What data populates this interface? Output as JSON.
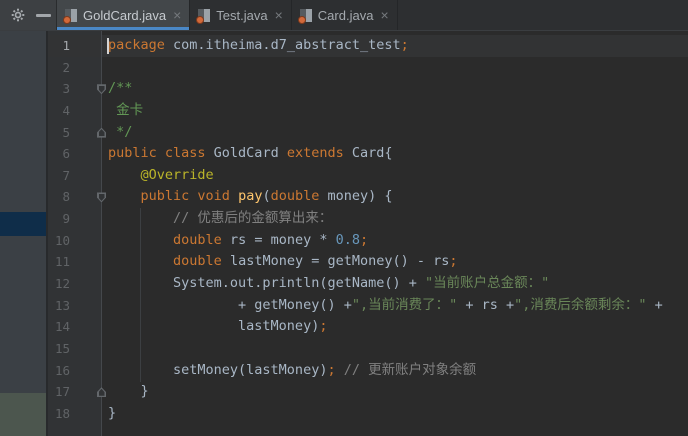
{
  "colors": {
    "editor_bg": "#2b2b2b",
    "gutter_bg": "#313335",
    "caret_line_bg": "#323334",
    "tab_active_underline": "#4a88c7",
    "panel_strip_bg": "#3b4045",
    "panel_strip_selection_blue": "#0f2d49",
    "panel_strip_band_green": "#4c564e",
    "keyword_orange": "#cc7832",
    "string_green": "#6a8759",
    "doc_comment_green": "#629755",
    "line_comment_gray": "#808080",
    "number_blue": "#6897bb",
    "annotation_yellow": "#bbb529",
    "method_yellow": "#ffc66d"
  },
  "topbar": {
    "icons": [
      {
        "name": "gear-icon"
      },
      {
        "name": "hide-panel-icon"
      }
    ],
    "tabs": [
      {
        "label": "GoldCard.java",
        "close": "×",
        "active": true
      },
      {
        "label": "Test.java",
        "close": "×",
        "active": false
      },
      {
        "label": "Card.java",
        "close": "×",
        "active": false
      }
    ]
  },
  "editor": {
    "caret_line": 1,
    "lines": [
      {
        "n": "1",
        "fold": null,
        "current": true,
        "segs": [
          {
            "t": "package ",
            "c": "kw"
          },
          {
            "t": "com.itheima.d7_abstract_test",
            "c": "fg"
          },
          {
            "t": ";",
            "c": "kw"
          }
        ]
      },
      {
        "n": "2",
        "fold": null,
        "current": false,
        "segs": []
      },
      {
        "n": "3",
        "fold": "down",
        "current": false,
        "segs": [
          {
            "t": "/**",
            "c": "doc"
          }
        ]
      },
      {
        "n": "4",
        "fold": null,
        "current": false,
        "segs": [
          {
            "t": " 金卡",
            "c": "doc"
          }
        ]
      },
      {
        "n": "5",
        "fold": "up",
        "current": false,
        "segs": [
          {
            "t": " */",
            "c": "doc"
          }
        ]
      },
      {
        "n": "6",
        "fold": null,
        "current": false,
        "segs": [
          {
            "t": "public class ",
            "c": "kw"
          },
          {
            "t": "GoldCard ",
            "c": "fg"
          },
          {
            "t": "extends ",
            "c": "kw"
          },
          {
            "t": "Card{",
            "c": "fg"
          }
        ]
      },
      {
        "n": "7",
        "fold": null,
        "current": false,
        "segs": [
          {
            "t": "    ",
            "c": "fg"
          },
          {
            "t": "@Override",
            "c": "ann"
          }
        ]
      },
      {
        "n": "8",
        "fold": "down",
        "current": false,
        "segs": [
          {
            "t": "    ",
            "c": "fg"
          },
          {
            "t": "public void ",
            "c": "kw"
          },
          {
            "t": "pay",
            "c": "meth"
          },
          {
            "t": "(",
            "c": "fg"
          },
          {
            "t": "double",
            "c": "kw"
          },
          {
            "t": " money) {",
            "c": "fg"
          }
        ]
      },
      {
        "n": "9",
        "fold": null,
        "current": false,
        "segs": [
          {
            "t": "        // 优惠后的金额算出来：",
            "c": "cmt"
          }
        ]
      },
      {
        "n": "10",
        "fold": null,
        "current": false,
        "segs": [
          {
            "t": "        ",
            "c": "fg"
          },
          {
            "t": "double ",
            "c": "kw"
          },
          {
            "t": "rs = money * ",
            "c": "fg"
          },
          {
            "t": "0.8",
            "c": "num"
          },
          {
            "t": ";",
            "c": "kw"
          }
        ]
      },
      {
        "n": "11",
        "fold": null,
        "current": false,
        "segs": [
          {
            "t": "        ",
            "c": "fg"
          },
          {
            "t": "double ",
            "c": "kw"
          },
          {
            "t": "lastMoney = getMoney() - rs",
            "c": "fg"
          },
          {
            "t": ";",
            "c": "kw"
          }
        ]
      },
      {
        "n": "12",
        "fold": null,
        "current": false,
        "segs": [
          {
            "t": "        System.out.println(getName() + ",
            "c": "fg"
          },
          {
            "t": "\"当前账户总金额：\"",
            "c": "str"
          }
        ]
      },
      {
        "n": "13",
        "fold": null,
        "current": false,
        "segs": [
          {
            "t": "                + getMoney() +",
            "c": "fg"
          },
          {
            "t": "\",当前消费了：\"",
            "c": "str"
          },
          {
            "t": " + rs +",
            "c": "fg"
          },
          {
            "t": "\",消费后余额剩余：\"",
            "c": "str"
          },
          {
            "t": " +",
            "c": "fg"
          }
        ]
      },
      {
        "n": "14",
        "fold": null,
        "current": false,
        "segs": [
          {
            "t": "                lastMoney)",
            "c": "fg"
          },
          {
            "t": ";",
            "c": "kw"
          }
        ]
      },
      {
        "n": "15",
        "fold": null,
        "current": false,
        "segs": []
      },
      {
        "n": "16",
        "fold": null,
        "current": false,
        "segs": [
          {
            "t": "        setMoney(lastMoney)",
            "c": "fg"
          },
          {
            "t": ";",
            "c": "kw"
          },
          {
            "t": " // 更新账户对象余额",
            "c": "cmt"
          }
        ]
      },
      {
        "n": "17",
        "fold": "up",
        "current": false,
        "segs": [
          {
            "t": "    }",
            "c": "fg"
          }
        ]
      },
      {
        "n": "18",
        "fold": null,
        "current": false,
        "segs": [
          {
            "t": "}",
            "c": "fg"
          }
        ]
      }
    ]
  }
}
